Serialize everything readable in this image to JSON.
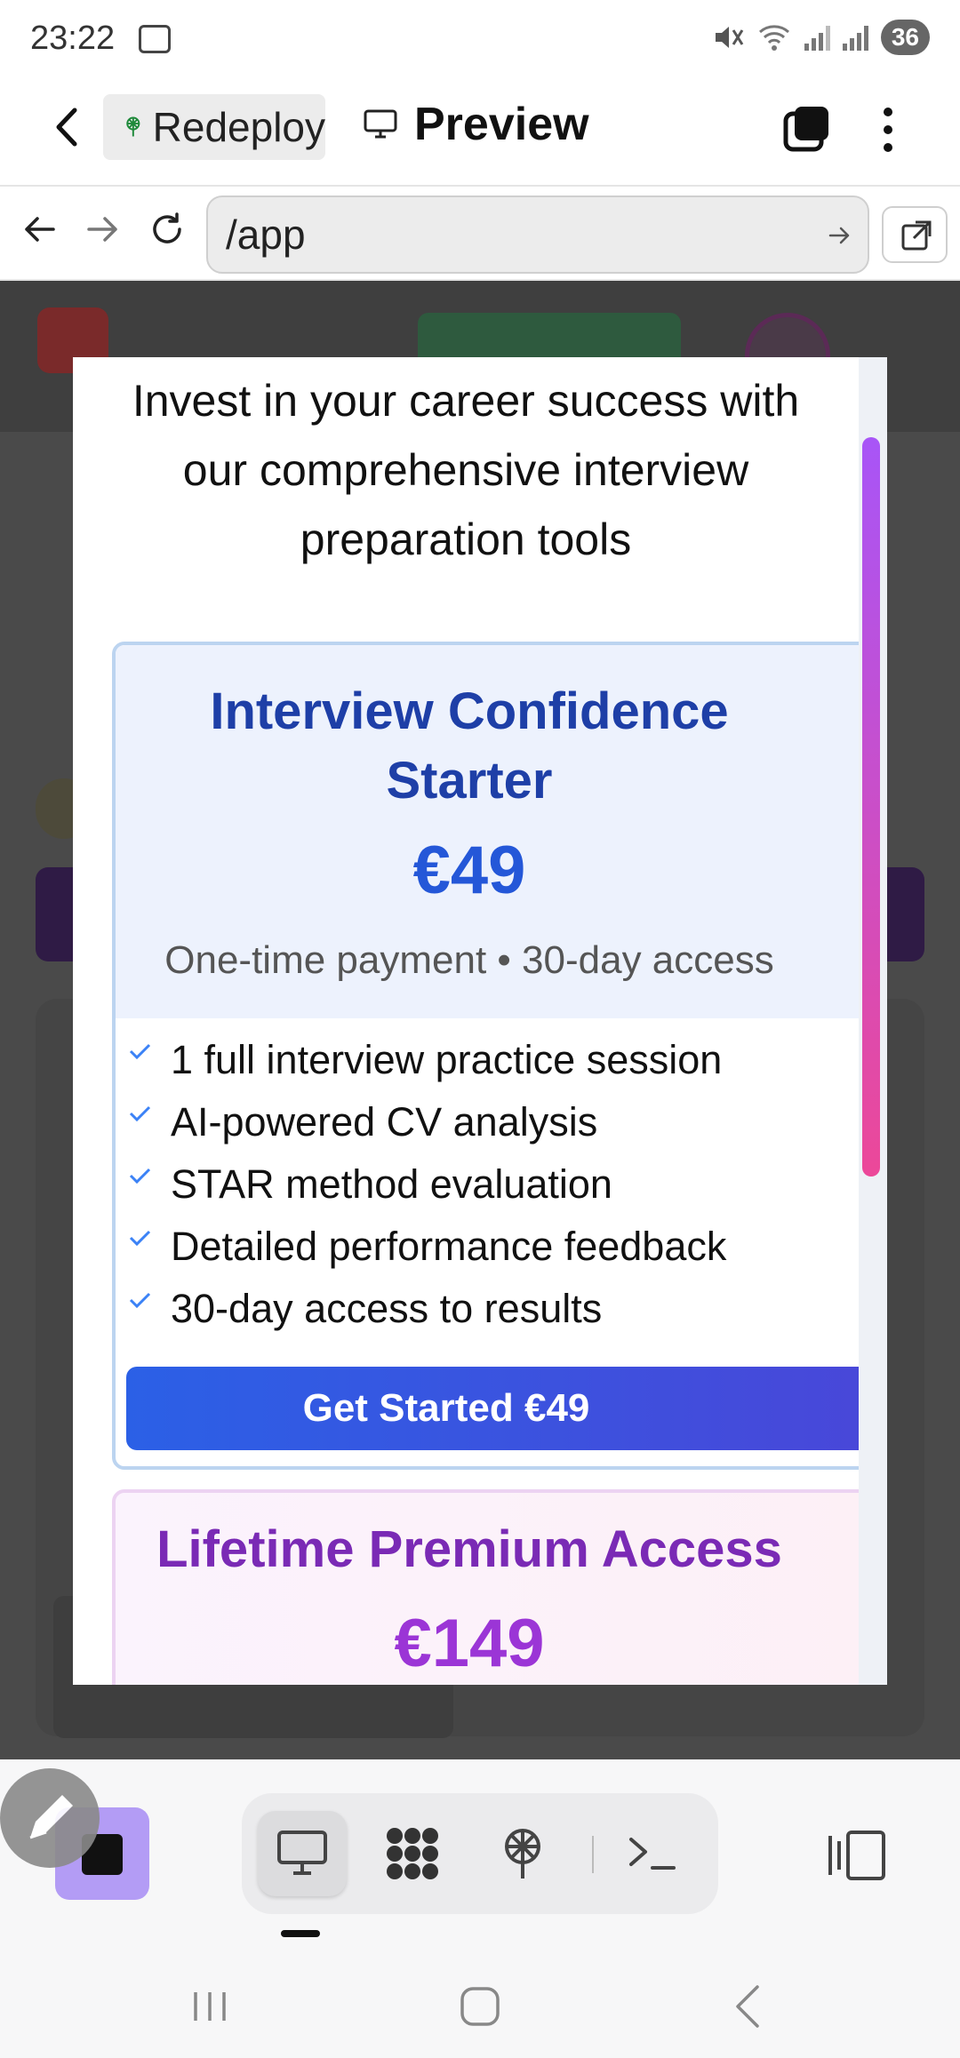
{
  "status_bar": {
    "time": "23:22",
    "battery": "36"
  },
  "header": {
    "back_icon": "chevron-left-icon",
    "project_chip": "Redeploy",
    "preview_label": "Preview"
  },
  "url_bar": {
    "value": "/app"
  },
  "modal": {
    "intro_lines": [
      "Invest in your career success with",
      "our comprehensive interview",
      "preparation tools"
    ],
    "starter": {
      "title_line1": "Interview Confidence",
      "title_line2": "Starter",
      "price": "€49",
      "subtitle": "One-time payment • 30-day access",
      "features": [
        "1 full interview practice session",
        "AI-powered CV analysis",
        "STAR method evaluation",
        "Detailed performance feedback",
        "30-day access to results"
      ],
      "cta": "Get Started €49"
    },
    "lifetime": {
      "title": "Lifetime Premium Access",
      "price": "€149"
    }
  },
  "colors": {
    "starter_title": "#1e3fa7",
    "starter_price": "#2457d8",
    "cta_start": "#2b60e6",
    "cta_end": "#4a46d8",
    "lifetime_title": "#7a2ab5",
    "lifetime_price": "#9b35d6",
    "scroll_thumb_start": "#a855f7",
    "scroll_thumb_end": "#ec4899",
    "stop_button": "#b39cf5"
  }
}
